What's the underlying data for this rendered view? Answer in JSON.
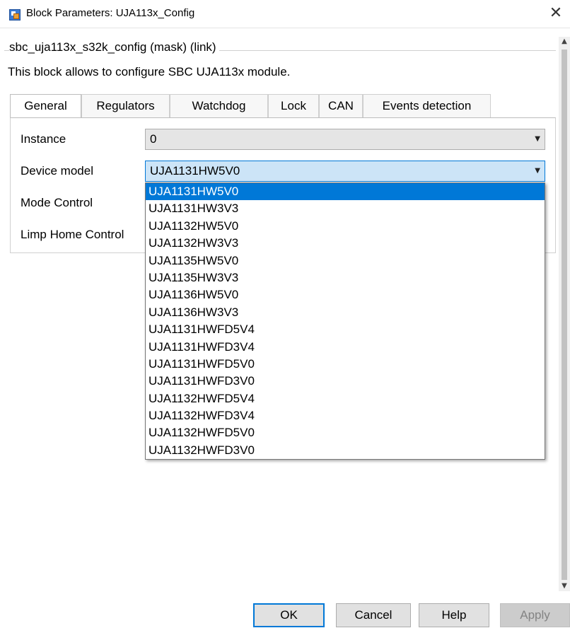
{
  "window": {
    "title": "Block Parameters: UJA113x_Config",
    "close_glyph": "✕"
  },
  "group": {
    "legend": "sbc_uja113x_s32k_config (mask) (link)",
    "description": "This block allows to configure SBC UJA113x module."
  },
  "tabs": [
    {
      "label": "General",
      "active": true
    },
    {
      "label": "Regulators",
      "active": false
    },
    {
      "label": "Watchdog",
      "active": false
    },
    {
      "label": "Lock",
      "active": false
    },
    {
      "label": "CAN",
      "active": false
    },
    {
      "label": "Events detection",
      "active": false
    }
  ],
  "fields": {
    "instance": {
      "label": "Instance",
      "value": "0"
    },
    "device_model": {
      "label": "Device model",
      "value": "UJA1131HW5V0"
    },
    "mode_control": {
      "label": "Mode Control"
    },
    "limp_home_control": {
      "label": "Limp Home Control"
    }
  },
  "dropdown": {
    "options": [
      "UJA1131HW5V0",
      "UJA1131HW3V3",
      "UJA1132HW5V0",
      "UJA1132HW3V3",
      "UJA1135HW5V0",
      "UJA1135HW3V3",
      "UJA1136HW5V0",
      "UJA1136HW3V3",
      "UJA1131HWFD5V4",
      "UJA1131HWFD3V4",
      "UJA1131HWFD5V0",
      "UJA1131HWFD3V0",
      "UJA1132HWFD5V4",
      "UJA1132HWFD3V4",
      "UJA1132HWFD5V0",
      "UJA1132HWFD3V0"
    ],
    "selected_index": 0
  },
  "buttons": {
    "ok": "OK",
    "cancel": "Cancel",
    "help": "Help",
    "apply": "Apply"
  },
  "colors": {
    "accent": "#0078d7",
    "selection_bg": "#0078d7",
    "combo_focus_bg": "#cce4f7"
  }
}
